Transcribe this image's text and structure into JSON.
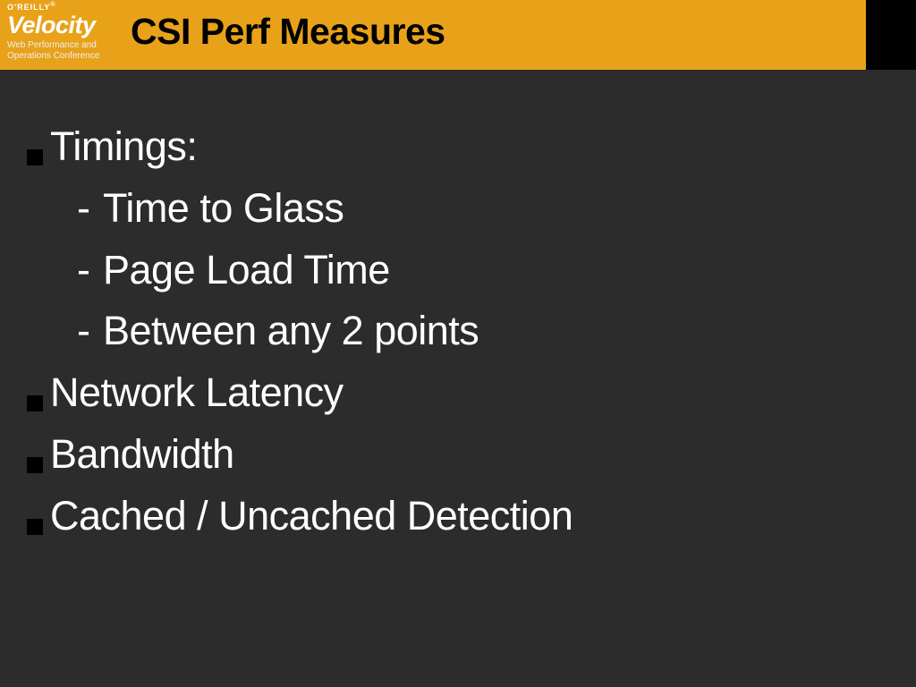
{
  "header": {
    "publisher": "O'REILLY",
    "logo_text": "Velocity",
    "tagline_line1": "Web Performance and",
    "tagline_line2": "Operations Conference",
    "slide_title": "CSI Perf Measures"
  },
  "content": {
    "bullets": [
      {
        "text": "Timings:",
        "subs": [
          "Time to Glass",
          "Page Load Time",
          "Between any 2 points"
        ]
      },
      {
        "text": "Network Latency",
        "subs": []
      },
      {
        "text": "Bandwidth",
        "subs": []
      },
      {
        "text": "Cached / Uncached Detection",
        "subs": []
      }
    ]
  }
}
